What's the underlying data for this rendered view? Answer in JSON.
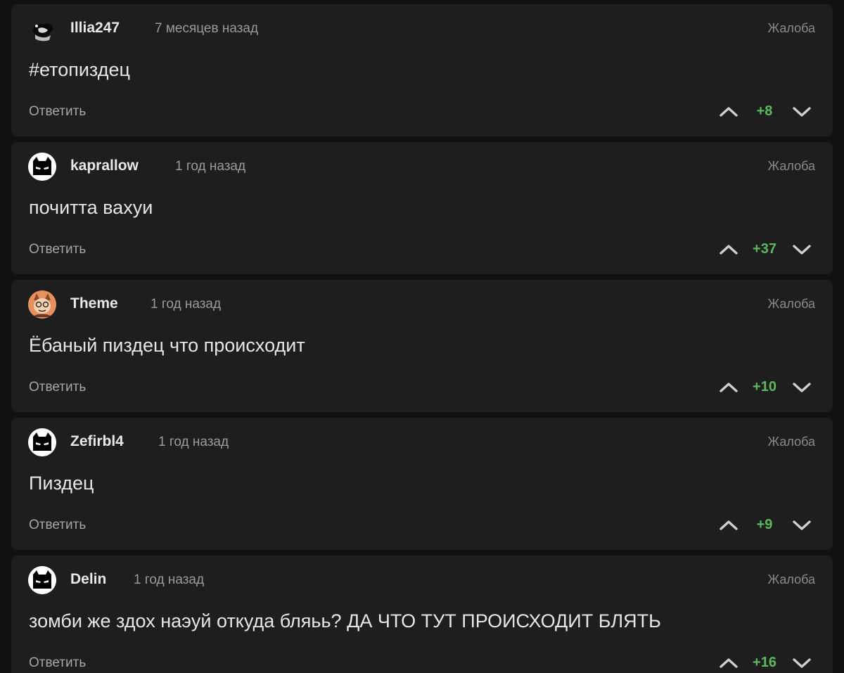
{
  "report_label": "Жалоба",
  "reply_label": "Ответить",
  "score_color": "#5cb85c",
  "comments": [
    {
      "username": "Illia247",
      "timestamp": "7 месяцев назад",
      "text": "#етопиздец",
      "score": "+8",
      "avatar_icon": "dark-creature-avatar-icon"
    },
    {
      "username": "kaprallow",
      "timestamp": "1 год назад",
      "text": "почитта вахуи",
      "score": "+37",
      "avatar_icon": "batman-mask-avatar-icon"
    },
    {
      "username": "Theme",
      "timestamp": "1 год назад",
      "text": "Ёбаный пиздец что происходит",
      "score": "+10",
      "avatar_icon": "cartoon-character-avatar-icon"
    },
    {
      "username": "Zefirbl4",
      "timestamp": "1 год назад",
      "text": "Пиздец",
      "score": "+9",
      "avatar_icon": "batman-mask-avatar-icon"
    },
    {
      "username": "Delin",
      "timestamp": "1 год назад",
      "text": "зомби же здох наэуй откуда бляьь? ДА ЧТО ТУТ ПРОИСХОДИТ БЛЯТЬ",
      "score": "+16",
      "avatar_icon": "batman-mask-avatar-icon"
    }
  ]
}
